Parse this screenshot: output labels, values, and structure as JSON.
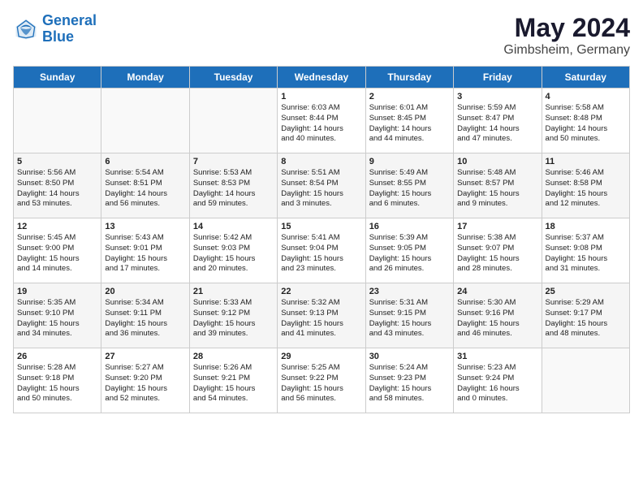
{
  "header": {
    "logo_line1": "General",
    "logo_line2": "Blue",
    "main_title": "May 2024",
    "subtitle": "Gimbsheim, Germany"
  },
  "days_of_week": [
    "Sunday",
    "Monday",
    "Tuesday",
    "Wednesday",
    "Thursday",
    "Friday",
    "Saturday"
  ],
  "weeks": [
    [
      {
        "day": "",
        "info": ""
      },
      {
        "day": "",
        "info": ""
      },
      {
        "day": "",
        "info": ""
      },
      {
        "day": "1",
        "info": "Sunrise: 6:03 AM\nSunset: 8:44 PM\nDaylight: 14 hours\nand 40 minutes."
      },
      {
        "day": "2",
        "info": "Sunrise: 6:01 AM\nSunset: 8:45 PM\nDaylight: 14 hours\nand 44 minutes."
      },
      {
        "day": "3",
        "info": "Sunrise: 5:59 AM\nSunset: 8:47 PM\nDaylight: 14 hours\nand 47 minutes."
      },
      {
        "day": "4",
        "info": "Sunrise: 5:58 AM\nSunset: 8:48 PM\nDaylight: 14 hours\nand 50 minutes."
      }
    ],
    [
      {
        "day": "5",
        "info": "Sunrise: 5:56 AM\nSunset: 8:50 PM\nDaylight: 14 hours\nand 53 minutes."
      },
      {
        "day": "6",
        "info": "Sunrise: 5:54 AM\nSunset: 8:51 PM\nDaylight: 14 hours\nand 56 minutes."
      },
      {
        "day": "7",
        "info": "Sunrise: 5:53 AM\nSunset: 8:53 PM\nDaylight: 14 hours\nand 59 minutes."
      },
      {
        "day": "8",
        "info": "Sunrise: 5:51 AM\nSunset: 8:54 PM\nDaylight: 15 hours\nand 3 minutes."
      },
      {
        "day": "9",
        "info": "Sunrise: 5:49 AM\nSunset: 8:55 PM\nDaylight: 15 hours\nand 6 minutes."
      },
      {
        "day": "10",
        "info": "Sunrise: 5:48 AM\nSunset: 8:57 PM\nDaylight: 15 hours\nand 9 minutes."
      },
      {
        "day": "11",
        "info": "Sunrise: 5:46 AM\nSunset: 8:58 PM\nDaylight: 15 hours\nand 12 minutes."
      }
    ],
    [
      {
        "day": "12",
        "info": "Sunrise: 5:45 AM\nSunset: 9:00 PM\nDaylight: 15 hours\nand 14 minutes."
      },
      {
        "day": "13",
        "info": "Sunrise: 5:43 AM\nSunset: 9:01 PM\nDaylight: 15 hours\nand 17 minutes."
      },
      {
        "day": "14",
        "info": "Sunrise: 5:42 AM\nSunset: 9:03 PM\nDaylight: 15 hours\nand 20 minutes."
      },
      {
        "day": "15",
        "info": "Sunrise: 5:41 AM\nSunset: 9:04 PM\nDaylight: 15 hours\nand 23 minutes."
      },
      {
        "day": "16",
        "info": "Sunrise: 5:39 AM\nSunset: 9:05 PM\nDaylight: 15 hours\nand 26 minutes."
      },
      {
        "day": "17",
        "info": "Sunrise: 5:38 AM\nSunset: 9:07 PM\nDaylight: 15 hours\nand 28 minutes."
      },
      {
        "day": "18",
        "info": "Sunrise: 5:37 AM\nSunset: 9:08 PM\nDaylight: 15 hours\nand 31 minutes."
      }
    ],
    [
      {
        "day": "19",
        "info": "Sunrise: 5:35 AM\nSunset: 9:10 PM\nDaylight: 15 hours\nand 34 minutes."
      },
      {
        "day": "20",
        "info": "Sunrise: 5:34 AM\nSunset: 9:11 PM\nDaylight: 15 hours\nand 36 minutes."
      },
      {
        "day": "21",
        "info": "Sunrise: 5:33 AM\nSunset: 9:12 PM\nDaylight: 15 hours\nand 39 minutes."
      },
      {
        "day": "22",
        "info": "Sunrise: 5:32 AM\nSunset: 9:13 PM\nDaylight: 15 hours\nand 41 minutes."
      },
      {
        "day": "23",
        "info": "Sunrise: 5:31 AM\nSunset: 9:15 PM\nDaylight: 15 hours\nand 43 minutes."
      },
      {
        "day": "24",
        "info": "Sunrise: 5:30 AM\nSunset: 9:16 PM\nDaylight: 15 hours\nand 46 minutes."
      },
      {
        "day": "25",
        "info": "Sunrise: 5:29 AM\nSunset: 9:17 PM\nDaylight: 15 hours\nand 48 minutes."
      }
    ],
    [
      {
        "day": "26",
        "info": "Sunrise: 5:28 AM\nSunset: 9:18 PM\nDaylight: 15 hours\nand 50 minutes."
      },
      {
        "day": "27",
        "info": "Sunrise: 5:27 AM\nSunset: 9:20 PM\nDaylight: 15 hours\nand 52 minutes."
      },
      {
        "day": "28",
        "info": "Sunrise: 5:26 AM\nSunset: 9:21 PM\nDaylight: 15 hours\nand 54 minutes."
      },
      {
        "day": "29",
        "info": "Sunrise: 5:25 AM\nSunset: 9:22 PM\nDaylight: 15 hours\nand 56 minutes."
      },
      {
        "day": "30",
        "info": "Sunrise: 5:24 AM\nSunset: 9:23 PM\nDaylight: 15 hours\nand 58 minutes."
      },
      {
        "day": "31",
        "info": "Sunrise: 5:23 AM\nSunset: 9:24 PM\nDaylight: 16 hours\nand 0 minutes."
      },
      {
        "day": "",
        "info": ""
      }
    ]
  ]
}
